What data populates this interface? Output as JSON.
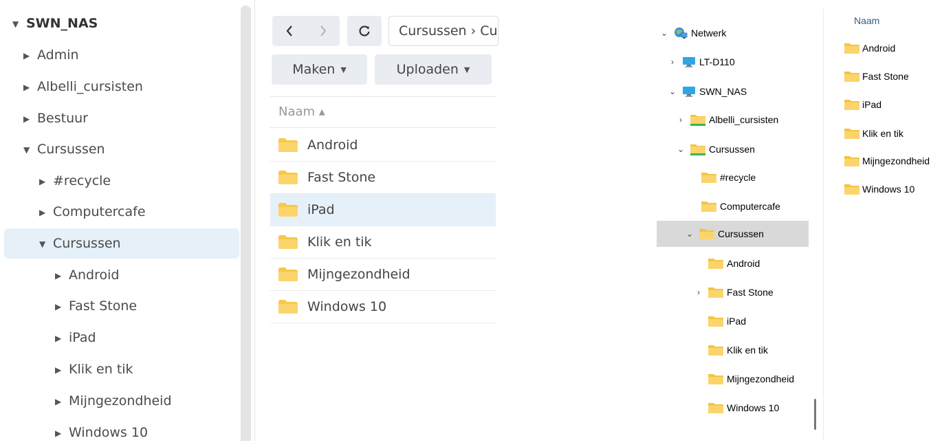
{
  "synology": {
    "tree": {
      "root": "SWN_NAS",
      "items": [
        {
          "label": "Admin",
          "expanded": false
        },
        {
          "label": "Albelli_cursisten",
          "expanded": false
        },
        {
          "label": "Bestuur",
          "expanded": false
        },
        {
          "label": "Cursussen",
          "expanded": true
        },
        {
          "label": "#recycle",
          "expanded": false
        },
        {
          "label": "Computercafe",
          "expanded": false
        },
        {
          "label": "Cursussen",
          "expanded": true,
          "selected": true
        },
        {
          "label": "Android",
          "expanded": false
        },
        {
          "label": "Fast Stone",
          "expanded": false
        },
        {
          "label": "iPad",
          "expanded": false
        },
        {
          "label": "Klik en tik",
          "expanded": false
        },
        {
          "label": "Mijngezondheid",
          "expanded": false
        },
        {
          "label": "Windows 10",
          "expanded": false
        }
      ]
    },
    "toolbar": {
      "back_icon": "chevron-left-icon",
      "forward_icon": "chevron-right-icon",
      "refresh_icon": "refresh-icon",
      "path": "Cursussen › Cursussen",
      "create_label": "Maken",
      "upload_label": "Uploaden"
    },
    "list": {
      "header": "Naam ▴",
      "files": [
        "Android",
        "Fast Stone",
        "iPad",
        "Klik en tik",
        "Mijngezondheid",
        "Windows 10"
      ],
      "selected": "iPad"
    },
    "colors": {
      "accent_selected": "#e6f0f9",
      "folder": "#f7c948"
    }
  },
  "windows": {
    "tree": {
      "items": [
        {
          "label": "Netwerk",
          "chevron": "⌄",
          "icon": "network-icon"
        },
        {
          "label": "LT-D110",
          "chevron": "›",
          "icon": "computer-icon"
        },
        {
          "label": "SWN_NAS",
          "chevron": "⌄",
          "icon": "computer-icon"
        },
        {
          "label": "Albelli_cursisten",
          "chevron": "›",
          "icon": "share-folder-icon"
        },
        {
          "label": "Cursussen",
          "chevron": "⌄",
          "icon": "share-folder-icon"
        },
        {
          "label": "#recycle",
          "chevron": "",
          "icon": "folder-icon"
        },
        {
          "label": "Computercafe",
          "chevron": "",
          "icon": "folder-icon"
        },
        {
          "label": "Cursussen",
          "chevron": "⌄",
          "icon": "folder-icon",
          "selected": true
        },
        {
          "label": "Android",
          "chevron": "",
          "icon": "folder-icon"
        },
        {
          "label": "Fast Stone",
          "chevron": "›",
          "icon": "folder-icon"
        },
        {
          "label": "iPad",
          "chevron": "",
          "icon": "folder-icon"
        },
        {
          "label": "Klik en tik",
          "chevron": "",
          "icon": "folder-icon"
        },
        {
          "label": "Mijngezondheid",
          "chevron": "",
          "icon": "folder-icon"
        },
        {
          "label": "Windows 10",
          "chevron": "",
          "icon": "folder-icon"
        }
      ]
    },
    "list": {
      "header": "Naam",
      "files": [
        "Android",
        "Fast Stone",
        "iPad",
        "Klik en tik",
        "Mijngezondheid",
        "Windows 10"
      ]
    }
  }
}
